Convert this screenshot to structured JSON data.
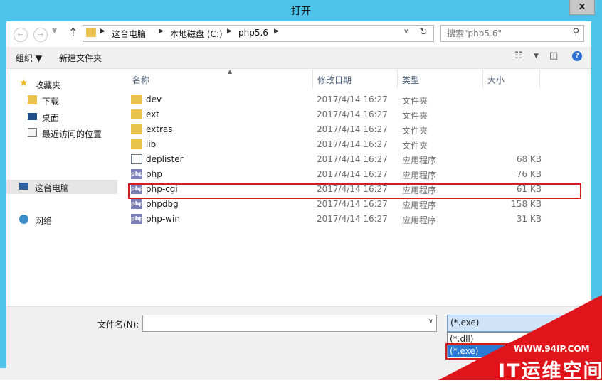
{
  "window": {
    "title": "打开",
    "close_label": "x"
  },
  "address": {
    "crumbs": [
      "这台电脑",
      "本地磁盘 (C:)",
      "php5.6"
    ]
  },
  "search": {
    "placeholder": "搜索\"php5.6\""
  },
  "toolbar": {
    "organize": "组织 ▼",
    "new_folder": "新建文件夹"
  },
  "navpane": {
    "items": [
      {
        "label": "收藏夹",
        "icon": "star-icon"
      },
      {
        "label": "下载",
        "icon": "download-folder-icon"
      },
      {
        "label": "桌面",
        "icon": "desktop-icon"
      },
      {
        "label": "最近访问的位置",
        "icon": "recent-places-icon"
      },
      {
        "label": "这台电脑",
        "icon": "computer-icon"
      },
      {
        "label": "网络",
        "icon": "network-icon"
      }
    ]
  },
  "columns": {
    "name": "名称",
    "date": "修改日期",
    "type": "类型",
    "size": "大小"
  },
  "files": [
    {
      "name": "dev",
      "date": "2017/4/14 16:27",
      "type": "文件夹",
      "size": "",
      "icon": "folder-icon"
    },
    {
      "name": "ext",
      "date": "2017/4/14 16:27",
      "type": "文件夹",
      "size": "",
      "icon": "folder-icon"
    },
    {
      "name": "extras",
      "date": "2017/4/14 16:27",
      "type": "文件夹",
      "size": "",
      "icon": "folder-icon"
    },
    {
      "name": "lib",
      "date": "2017/4/14 16:27",
      "type": "文件夹",
      "size": "",
      "icon": "folder-icon"
    },
    {
      "name": "deplister",
      "date": "2017/4/14 16:27",
      "type": "应用程序",
      "size": "68 KB",
      "icon": "exe-icon"
    },
    {
      "name": "php",
      "date": "2017/4/14 16:27",
      "type": "应用程序",
      "size": "76 KB",
      "icon": "php-icon"
    },
    {
      "name": "php-cgi",
      "date": "2017/4/14 16:27",
      "type": "应用程序",
      "size": "61 KB",
      "icon": "php-icon"
    },
    {
      "name": "phpdbg",
      "date": "2017/4/14 16:27",
      "type": "应用程序",
      "size": "158 KB",
      "icon": "php-icon"
    },
    {
      "name": "php-win",
      "date": "2017/4/14 16:27",
      "type": "应用程序",
      "size": "31 KB",
      "icon": "php-icon"
    }
  ],
  "bottom": {
    "filename_label": "文件名(N):",
    "filename_value": "",
    "filter_selected": "(*.exe)",
    "filter_options": [
      "(*.dll)",
      "(*.exe)"
    ]
  },
  "watermark": {
    "url": "WWW.94IP.COM",
    "text": "IT运维空间"
  },
  "colors": {
    "frame": "#4fc3ea",
    "highlight": "#d41e1e",
    "selection": "#2a7ad5",
    "watermark": "#e0151c"
  }
}
